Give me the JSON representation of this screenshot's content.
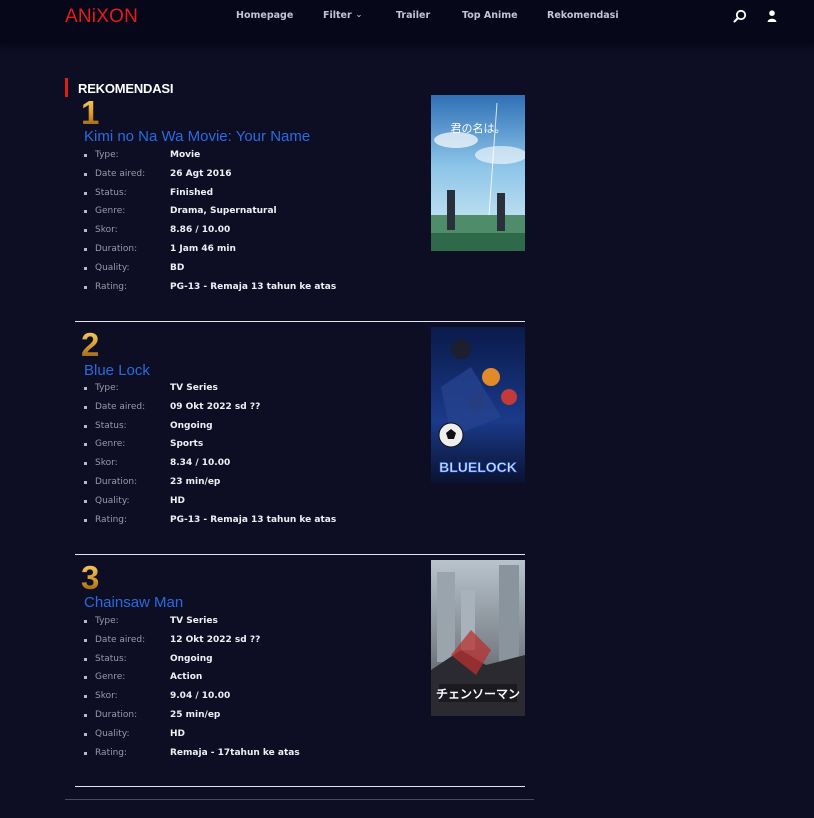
{
  "header": {
    "logo": "ANiXON",
    "nav": [
      "Homepage",
      "Filter",
      "Trailer",
      "Top Anime",
      "Rekomendasi"
    ],
    "icons": [
      "search-icon",
      "user-icon"
    ]
  },
  "section": {
    "title": "REKOMENDASI"
  },
  "items": [
    {
      "rank": "1",
      "title": "Kimi no Na Wa Movie: Your Name",
      "poster": {
        "caption": "君の名は。",
        "theme": "sky"
      },
      "fields": [
        {
          "key": "Type:",
          "value": "Movie"
        },
        {
          "key": "Date aired:",
          "value": "26 Agt 2016"
        },
        {
          "key": "Status:",
          "value": "Finished"
        },
        {
          "key": "Genre:",
          "value": "Drama, Supernatural"
        },
        {
          "key": "Skor:",
          "value": "8.86 / 10.00"
        },
        {
          "key": "Duration:",
          "value": "1 Jam 46 min"
        },
        {
          "key": "Quality:",
          "value": "BD"
        },
        {
          "key": "Rating:",
          "value": "PG-13 - Remaja 13 tahun ke atas"
        }
      ]
    },
    {
      "rank": "2",
      "title": "Blue Lock",
      "poster": {
        "caption": "BLUELOCK",
        "theme": "blue"
      },
      "fields": [
        {
          "key": "Type:",
          "value": "TV Series"
        },
        {
          "key": "Date aired:",
          "value": "09 Okt 2022 sd ??"
        },
        {
          "key": "Status:",
          "value": "Ongoing"
        },
        {
          "key": "Genre:",
          "value": "Sports"
        },
        {
          "key": "Skor:",
          "value": "8.34 / 10.00"
        },
        {
          "key": "Duration:",
          "value": "23 min/ep"
        },
        {
          "key": "Quality:",
          "value": "HD"
        },
        {
          "key": "Rating:",
          "value": "PG-13 - Remaja 13 tahun ke atas"
        }
      ]
    },
    {
      "rank": "3",
      "title": "Chainsaw Man",
      "poster": {
        "caption": "チェンソーマン",
        "theme": "grey"
      },
      "fields": [
        {
          "key": "Type:",
          "value": "TV Series"
        },
        {
          "key": "Date aired:",
          "value": "12 Okt 2022 sd ??"
        },
        {
          "key": "Status:",
          "value": "Ongoing"
        },
        {
          "key": "Genre:",
          "value": "Action"
        },
        {
          "key": "Skor:",
          "value": "9.04 / 10.00"
        },
        {
          "key": "Duration:",
          "value": "25 min/ep"
        },
        {
          "key": "Quality:",
          "value": "HD"
        },
        {
          "key": "Rating:",
          "value": "Remaja - 17tahun ke atas"
        }
      ]
    }
  ]
}
